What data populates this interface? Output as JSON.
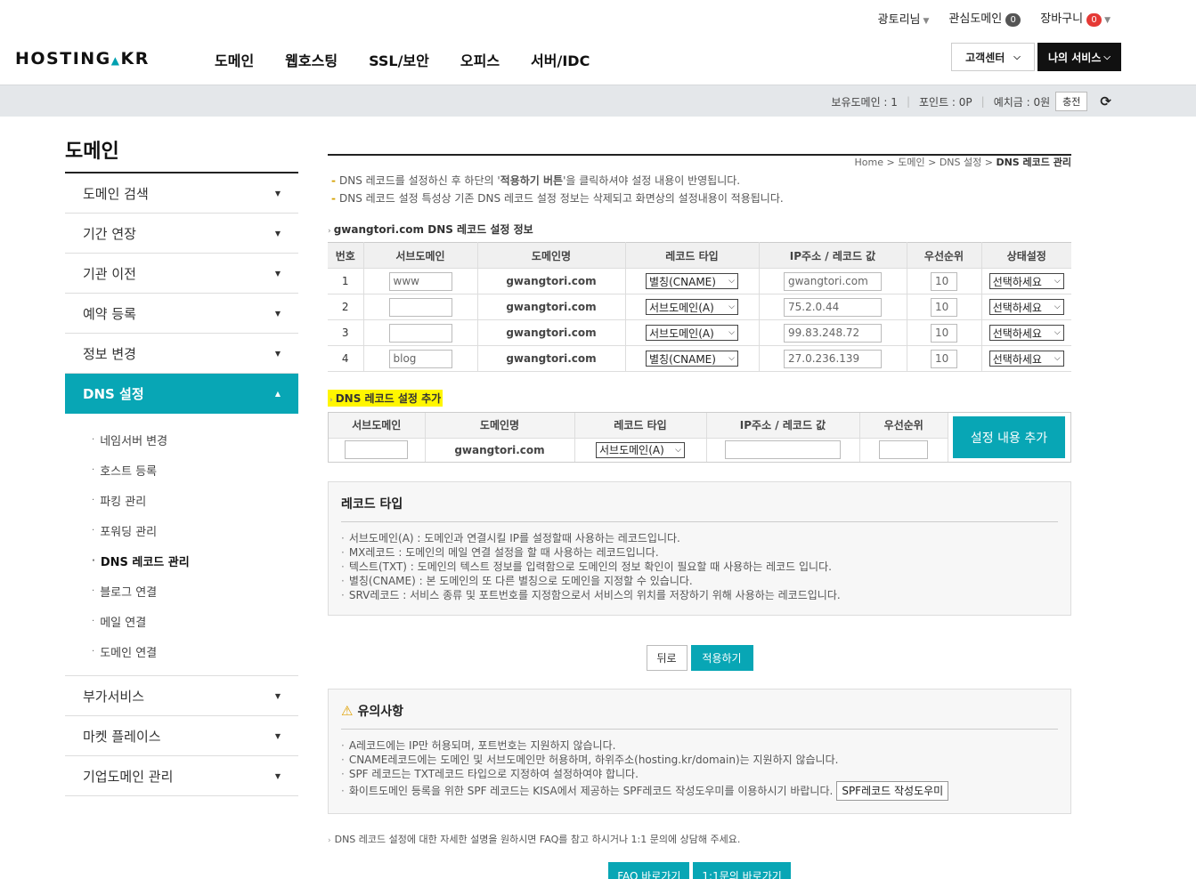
{
  "util": {
    "user": "광토리님",
    "favorites_label": "관심도메인",
    "favorites_count": "0",
    "cart_label": "장바구니",
    "cart_count": "0"
  },
  "header": {
    "logo": "HOSTING",
    "logo_suffix": "KR",
    "nav": [
      "도메인",
      "웹호스팅",
      "SSL/보안",
      "오피스",
      "서버/IDC"
    ],
    "cs_button": "고객센터",
    "my_service_button": "나의 서비스"
  },
  "account": {
    "domains": "보유도메인 : 1",
    "points": "포인트 : 0P",
    "deposit": "예치금 : 0원",
    "charge_button": "충전"
  },
  "sidebar": {
    "title": "도메인",
    "items_top": [
      "도메인 검색",
      "기간 연장",
      "기관 이전",
      "예약 등록",
      "정보 변경"
    ],
    "active": "DNS 설정",
    "subs": [
      "네임서버 변경",
      "호스트 등록",
      "파킹 관리",
      "포워딩 관리",
      "DNS 레코드 관리",
      "블로그 연결",
      "메일 연결",
      "도메인 연결"
    ],
    "items_bottom": [
      "부가서비스",
      "마켓 플레이스",
      "기업도메인 관리"
    ]
  },
  "breadcrumb": {
    "home": "Home",
    "level1": "도메인",
    "level2": "DNS 설정",
    "current": "DNS 레코드 관리"
  },
  "notice": {
    "line1_a": "DNS 레코드를 설정하신 후 하단의 '",
    "line1_b": "적용하기 버튼",
    "line1_c": "'을 클릭하셔야 설정 내용이 반영됩니다.",
    "line2": "DNS 레코드 설정 특성상 기존 DNS 레코드 설정 정보는 삭제되고 화면상의 설정내용이 적용됩니다."
  },
  "records": {
    "title": "gwangtori.com DNS 레코드 설정 정보",
    "headers": [
      "번호",
      "서브도메인",
      "도메인명",
      "레코드 타입",
      "IP주소 / 레코드 값",
      "우선순위",
      "상태설정"
    ],
    "rows": [
      {
        "no": "1",
        "sub": "www",
        "domain": "gwangtori.com",
        "type": "별칭(CNAME)",
        "value": "gwangtori.com",
        "priority": "10",
        "status": "선택하세요"
      },
      {
        "no": "2",
        "sub": "",
        "domain": "gwangtori.com",
        "type": "서브도메인(A)",
        "value": "75.2.0.44",
        "priority": "10",
        "status": "선택하세요"
      },
      {
        "no": "3",
        "sub": "",
        "domain": "gwangtori.com",
        "type": "서브도메인(A)",
        "value": "99.83.248.72",
        "priority": "10",
        "status": "선택하세요"
      },
      {
        "no": "4",
        "sub": "blog",
        "domain": "gwangtori.com",
        "type": "별칭(CNAME)",
        "value": "27.0.236.139",
        "priority": "10",
        "status": "선택하세요"
      }
    ]
  },
  "add": {
    "title": "DNS 레코드 설정 추가",
    "headers": [
      "서브도메인",
      "도메인명",
      "레코드 타입",
      "IP주소 / 레코드 값",
      "우선순위"
    ],
    "domain": "gwangtori.com",
    "type": "서브도메인(A)",
    "button": "설정 내용 추가"
  },
  "record_types": {
    "title": "레코드 타입",
    "items": [
      "서브도메인(A) : 도메인과 연결시킬 IP를 설정할때 사용하는 레코드입니다.",
      "MX레코드 : 도메인의 메일 연결 설정을 할 때 사용하는 레코드입니다.",
      "텍스트(TXT) : 도메인의 텍스트 정보를 입력함으로 도메인의 정보 확인이 필요할 때 사용하는 레코드 입니다.",
      "별칭(CNAME) : 본 도메인의 또 다른 별칭으로 도메인을 지정할 수 있습니다.",
      "SRV레코드 : 서비스 종류 및 포트번호를 지정함으로서 서비스의 위치를 저장하기 위해 사용하는 레코드입니다."
    ]
  },
  "buttons": {
    "back": "뒤로",
    "apply": "적용하기"
  },
  "caution": {
    "title": "유의사항",
    "items": [
      "A레코드에는 IP만 허용되며, 포트번호는 지원하지 않습니다.",
      "CNAME레코드에는 도메인 및 서브도메인만 허용하며, 하위주소(hosting.kr/domain)는 지원하지 않습니다.",
      "SPF 레코드는 TXT레코드 타입으로 지정하여 설정하여야 합니다.",
      "화이트도메인 등록을 위한 SPF 레코드는 KISA에서 제공하는 SPF레코드 작성도우미를 이용하시기 바랍니다."
    ],
    "spf_button": "SPF레코드 작성도우미"
  },
  "footer": {
    "note": "DNS 레코드 설정에 대한 자세한 설명을 원하시면 FAQ를 참고 하시거나 1:1 문의에 상담해 주세요.",
    "faq_button": "FAQ 바로가기",
    "qna_button": "1:1문의 바로가기"
  },
  "colors": {
    "accent": "#08a6b5",
    "highlight": "#fff600",
    "dark": "#111111"
  }
}
